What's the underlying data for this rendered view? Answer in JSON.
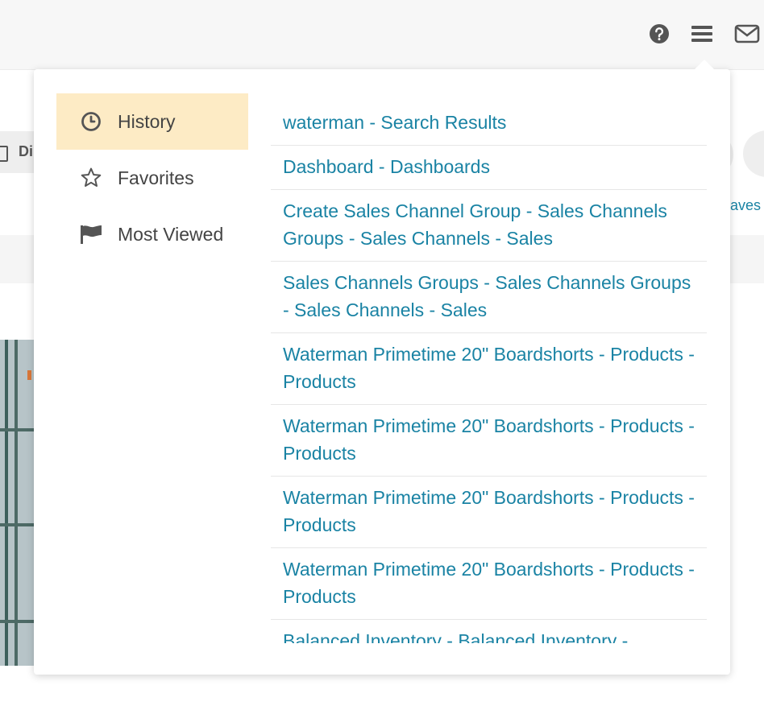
{
  "header": {
    "icons": [
      "help-icon",
      "menu-icon",
      "mail-icon"
    ]
  },
  "background": {
    "strip_text": "Di",
    "waves_text": "aves"
  },
  "panel": {
    "tabs": [
      {
        "label": "History",
        "icon": "clock-icon",
        "active": true
      },
      {
        "label": "Favorites",
        "icon": "star-icon",
        "active": false
      },
      {
        "label": "Most Viewed",
        "icon": "flag-icon",
        "active": false
      }
    ],
    "history": [
      "waterman - Search Results",
      "Dashboard - Dashboards",
      "Create Sales Channel Group - Sales Channels Groups - Sales Channels - Sales",
      "Sales Channels Groups - Sales Channels Groups - Sales Channels - Sales",
      "Waterman Primetime 20\" Boardshorts - Products - Products",
      "Waterman Primetime 20\" Boardshorts - Products - Products",
      "Waterman Primetime 20\" Boardshorts - Products - Products",
      "Waterman Primetime 20\" Boardshorts - Products - Products",
      "Balanced Inventory - Balanced Inventory -"
    ]
  },
  "colors": {
    "link": "#1a83a4",
    "active_tab_bg": "#fdebc5",
    "topbar_bg": "#f7f7f7"
  }
}
